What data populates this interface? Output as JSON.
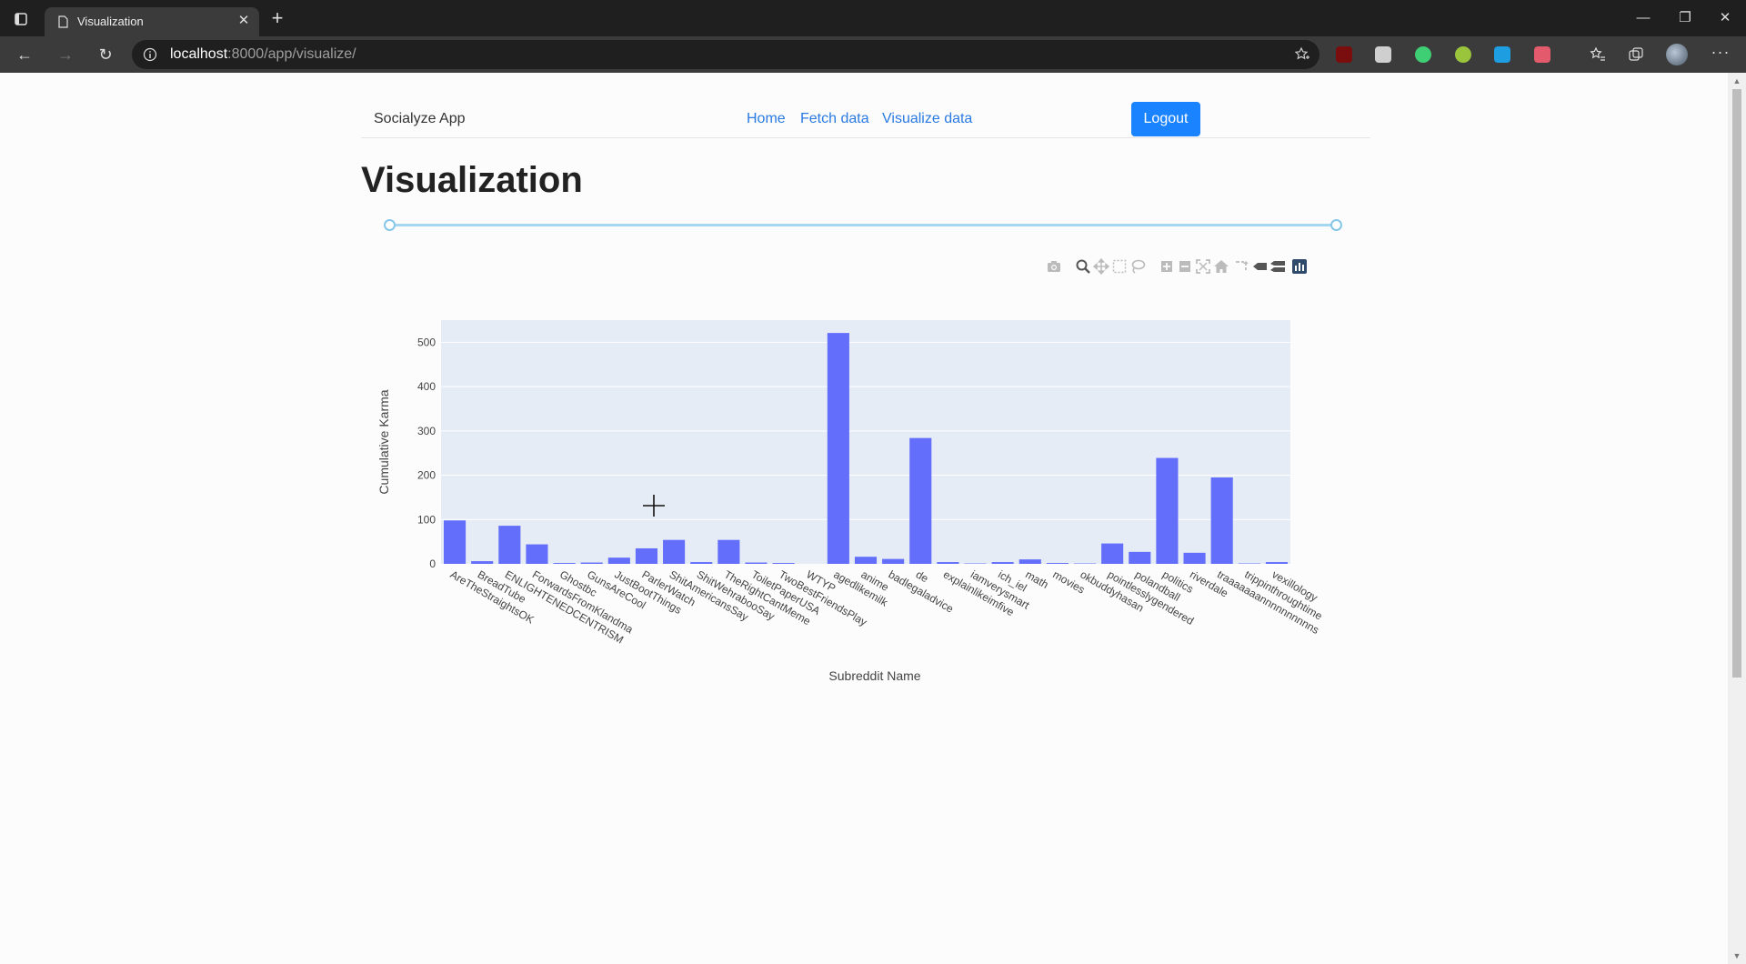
{
  "browser": {
    "tab_title": "Visualization",
    "url_host": "localhost",
    "url_rest": ":8000/app/visualize/"
  },
  "app": {
    "brand": "Socialyze App",
    "nav": [
      "Home",
      "Fetch data",
      "Visualize data"
    ],
    "logout_label": "Logout",
    "page_title": "Visualization"
  },
  "range_slider": {
    "low": 0,
    "high": 1
  },
  "colors": {
    "bar": "#636efa",
    "plot_bg": "#e5ecf6",
    "accent": "#1a83ff",
    "link": "#2a7ae2"
  },
  "modebar": [
    "camera-icon",
    "zoom-icon",
    "pan-icon",
    "box-select-icon",
    "lasso-select-icon",
    "zoom-in-icon",
    "zoom-out-icon",
    "autoscale-icon",
    "reset-axes-icon",
    "toggle-spike-lines-icon",
    "show-closest-icon",
    "compare-data-icon",
    "plotly-logo-icon"
  ],
  "chart_data": {
    "type": "bar",
    "xlabel": "Subreddit Name",
    "ylabel": "Cumulative Karma",
    "ylim": [
      0,
      550
    ],
    "yticks": [
      0,
      100,
      200,
      300,
      400,
      500
    ],
    "grid": true,
    "categories": [
      "AreTheStraightsOK",
      "BreadTube",
      "ENLIGHTENEDCENTRISM",
      "ForwardsFromKlandma",
      "Ghostbc",
      "GunsAreCool",
      "JustBootThings",
      "ParlerWatch",
      "ShitAmericansSay",
      "ShitWehrabooSay",
      "TheRightCantMeme",
      "ToiletPaperUSA",
      "TwoBestFriendsPlay",
      "WTYP",
      "agedlikemilk",
      "anime",
      "badlegaladvice",
      "de",
      "explainlikeimfive",
      "iamverysmart",
      "ich_iel",
      "math",
      "movies",
      "okbuddyhasan",
      "pointlesslygendered",
      "polandball",
      "politics",
      "riverdale",
      "traaaaaaannnnnnnnnns",
      "trippinthroughtime",
      "vexillology"
    ],
    "values": [
      98,
      6,
      86,
      44,
      2,
      3,
      14,
      35,
      54,
      4,
      54,
      3,
      2,
      0,
      521,
      16,
      11,
      284,
      4,
      1,
      4,
      10,
      2,
      1,
      46,
      27,
      239,
      25,
      195,
      1,
      4
    ]
  }
}
